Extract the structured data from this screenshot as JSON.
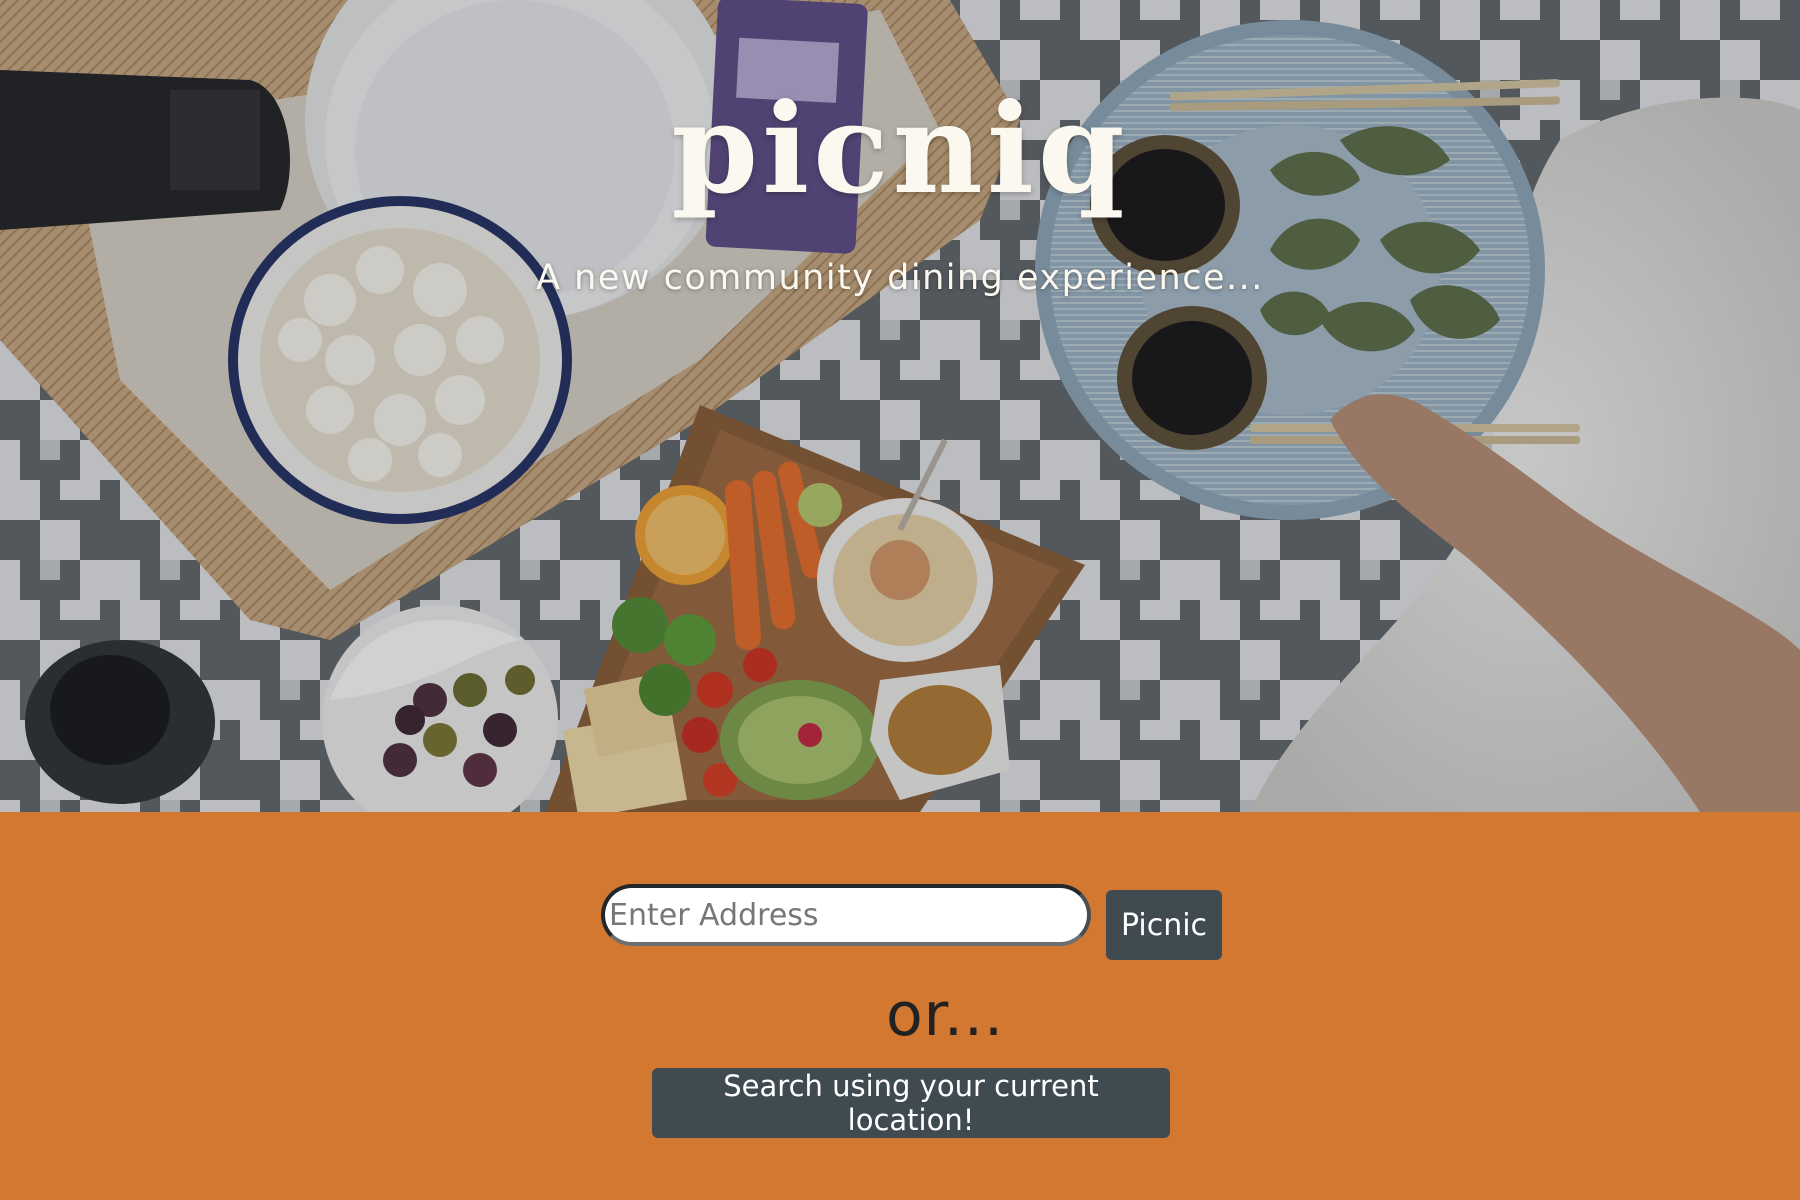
{
  "hero": {
    "title": "picniq",
    "tagline": "A new community dining experience..."
  },
  "search": {
    "placeholder": "Enter Address",
    "submit_label": "Picnic"
  },
  "alternate": {
    "or_label": "or...",
    "location_button_label": "Search using your current location!"
  },
  "colors": {
    "accent": "#d27830",
    "button": "#3f4a51",
    "title_text": "#fbf9ef"
  },
  "hero_image": {
    "icon": "picnic-food-photo"
  }
}
